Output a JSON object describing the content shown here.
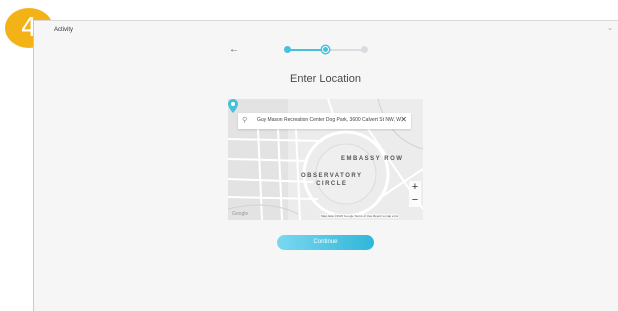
{
  "badge": {
    "number": "4",
    "color": "#f3b316"
  },
  "window": {
    "title": "Activity",
    "corner_icon": "chevron-down-icon"
  },
  "nav": {
    "back_icon": "back-arrow-icon",
    "back_glyph": "←"
  },
  "stepper": {
    "total_steps": 3,
    "current_step": 2,
    "accent": "#45c1de"
  },
  "page": {
    "title": "Enter Location"
  },
  "map": {
    "search_value": "Guy Mason Recreation Center Dog Park, 3600 Calvert St NW, W",
    "search_icon": "search-icon",
    "clear_glyph": "✕",
    "labels": {
      "embassy_row": "EMBASSY ROW",
      "observatory_line1": "OBSERVATORY",
      "observatory_line2": "CIRCLE"
    },
    "zoom_in": "+",
    "zoom_out": "−",
    "attribution": "Map data ©2020 Google   Terms of Use   Report a map error",
    "google": "Google",
    "pin_color": "#45c1de"
  },
  "actions": {
    "continue_label": "Continue"
  }
}
